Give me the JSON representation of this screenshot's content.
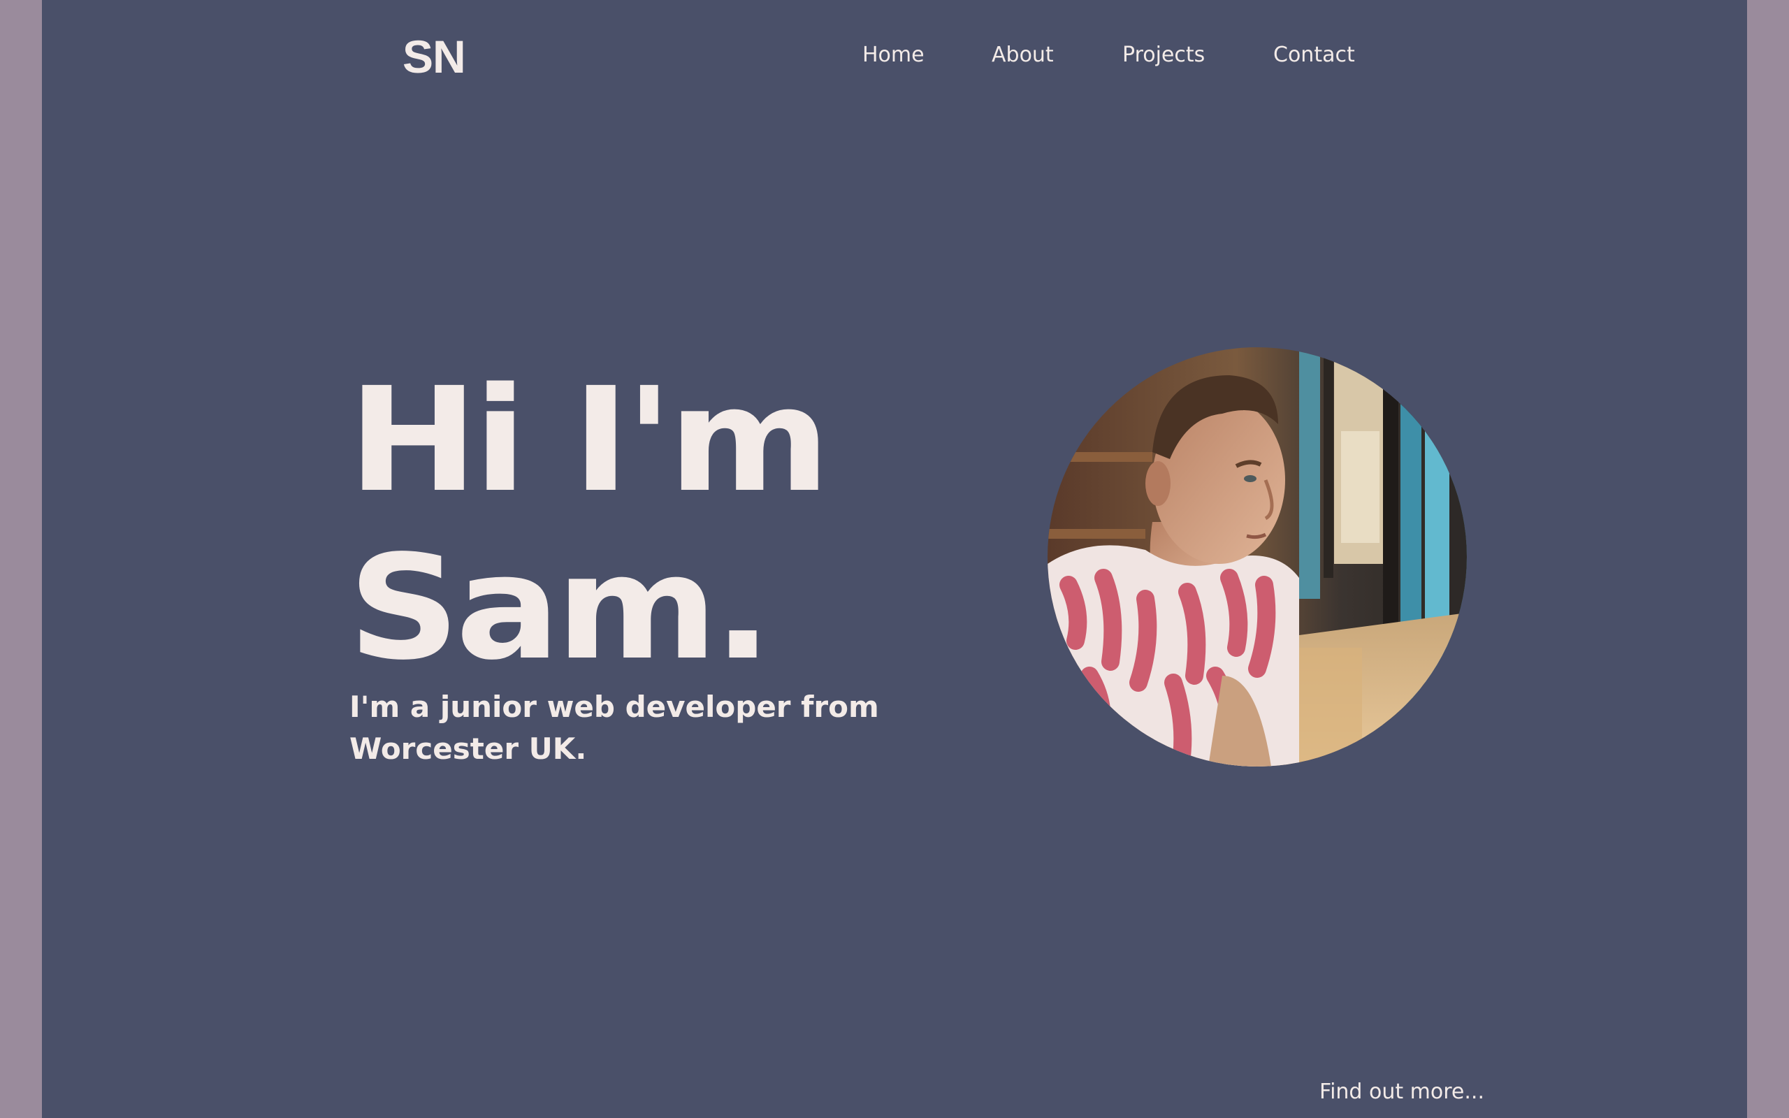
{
  "header": {
    "logo": "SN",
    "nav": [
      {
        "label": "Home"
      },
      {
        "label": "About"
      },
      {
        "label": "Projects"
      },
      {
        "label": "Contact"
      }
    ]
  },
  "hero": {
    "title_line1": "Hi I'm",
    "title_line2": "Sam.",
    "subtitle": "I'm a junior web developer from Worcester UK.",
    "photo_alt": "Portrait photo of Sam"
  },
  "footer": {
    "find_more": "Find out more..."
  },
  "colors": {
    "page_background": "#9a8b9c",
    "panel_background": "#4a5069",
    "text": "#f3ebe8"
  }
}
